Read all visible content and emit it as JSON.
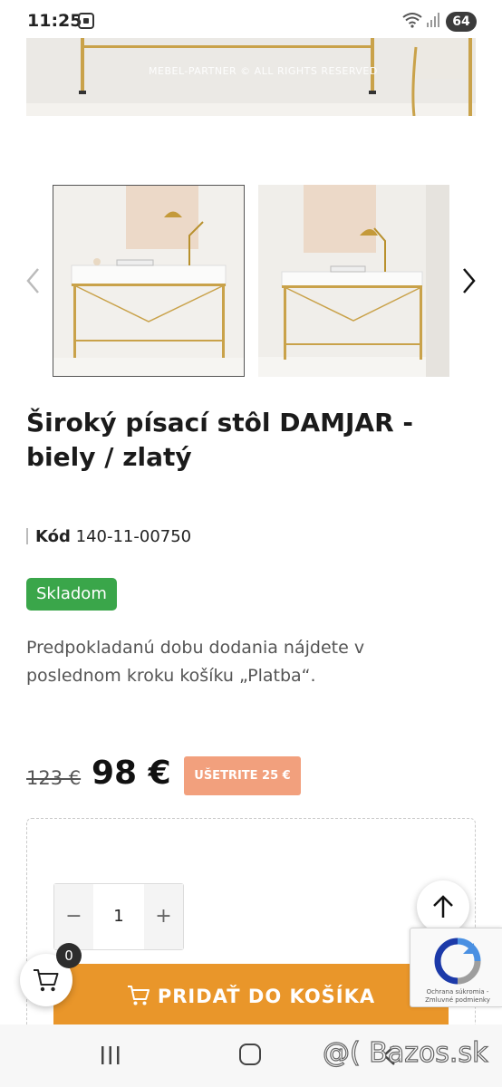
{
  "status_bar": {
    "time": "11:25",
    "battery": "64"
  },
  "gallery": {
    "hero_watermark": "MEBEL-PARTNER © ALL RIGHTS RESERVED",
    "thumbnails": [
      "thumbnail-1",
      "thumbnail-2"
    ]
  },
  "product": {
    "title": "Široký písací stôl DAMJAR - biely / zlatý",
    "code_label": "Kód",
    "code_value": "140-11-00750",
    "stock": "Skladom",
    "delivery": "Predpokladanú dobu dodania nájdete v poslednom kroku košíku „Platba“.",
    "price_old": "123 €",
    "price_new": "98 €",
    "save_label": "UŠETRITE 25 €"
  },
  "cart": {
    "quantity": "1",
    "minus": "−",
    "plus": "+",
    "add_label": "PRIDAŤ DO KOŠÍKA",
    "count": "0"
  },
  "recaptcha": {
    "text": "Ochrana súkromia - Zmluvné podmienky"
  },
  "watermark": "@( Bazos.sk",
  "colors": {
    "stock_green": "#3aa64a",
    "add_to_cart_orange": "#e9962a",
    "save_badge": "#f2a07d"
  }
}
